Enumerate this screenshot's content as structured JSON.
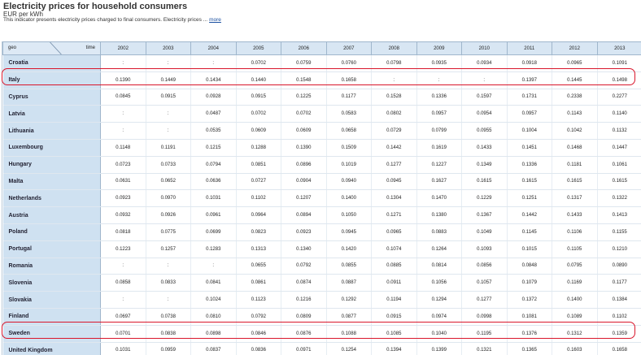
{
  "header": {
    "title": "Electricity prices for household consumers",
    "unit": "EUR per kWh",
    "description": "This indicator presents electricity prices charged to final consumers. Electricity prices ...",
    "more_label": "more"
  },
  "table": {
    "corner_geo": "geo",
    "corner_time": "time",
    "years": [
      "2002",
      "2003",
      "2004",
      "2005",
      "2006",
      "2007",
      "2008",
      "2009",
      "2010",
      "2011",
      "2012",
      "2013"
    ],
    "rows": [
      {
        "geo": "Croatia",
        "values": [
          ":",
          ":",
          ":",
          "0.0702",
          "0.0759",
          "0.0760",
          "0.0798",
          "0.0935",
          "0.0934",
          "0.0918",
          "0.0965",
          "0.1091"
        ]
      },
      {
        "geo": "Italy",
        "values": [
          "0.1390",
          "0.1449",
          "0.1434",
          "0.1440",
          "0.1548",
          "0.1658",
          ":",
          ":",
          ":",
          "0.1397",
          "0.1445",
          "0.1498"
        ]
      },
      {
        "geo": "Cyprus",
        "values": [
          "0.0845",
          "0.0915",
          "0.0928",
          "0.0915",
          "0.1225",
          "0.1177",
          "0.1528",
          "0.1336",
          "0.1597",
          "0.1731",
          "0.2338",
          "0.2277"
        ]
      },
      {
        "geo": "Latvia",
        "values": [
          ":",
          ":",
          "0.0487",
          "0.0702",
          "0.0702",
          "0.0583",
          "0.0802",
          "0.0957",
          "0.0954",
          "0.0957",
          "0.1143",
          "0.1140"
        ]
      },
      {
        "geo": "Lithuania",
        "values": [
          ":",
          ":",
          "0.0535",
          "0.0609",
          "0.0609",
          "0.0658",
          "0.0729",
          "0.0799",
          "0.0955",
          "0.1004",
          "0.1042",
          "0.1132"
        ]
      },
      {
        "geo": "Luxembourg",
        "values": [
          "0.1148",
          "0.1191",
          "0.1215",
          "0.1288",
          "0.1390",
          "0.1509",
          "0.1442",
          "0.1619",
          "0.1433",
          "0.1451",
          "0.1468",
          "0.1447"
        ]
      },
      {
        "geo": "Hungary",
        "values": [
          "0.0723",
          "0.0733",
          "0.0794",
          "0.0851",
          "0.0896",
          "0.1019",
          "0.1277",
          "0.1227",
          "0.1349",
          "0.1336",
          "0.1181",
          "0.1061"
        ]
      },
      {
        "geo": "Malta",
        "values": [
          "0.0631",
          "0.0652",
          "0.0636",
          "0.0727",
          "0.0904",
          "0.0940",
          "0.0945",
          "0.1627",
          "0.1615",
          "0.1615",
          "0.1615",
          "0.1615"
        ]
      },
      {
        "geo": "Netherlands",
        "values": [
          "0.0923",
          "0.0970",
          "0.1031",
          "0.1102",
          "0.1207",
          "0.1400",
          "0.1304",
          "0.1470",
          "0.1229",
          "0.1251",
          "0.1317",
          "0.1322"
        ]
      },
      {
        "geo": "Austria",
        "values": [
          "0.0932",
          "0.0926",
          "0.0961",
          "0.0964",
          "0.0894",
          "0.1050",
          "0.1271",
          "0.1380",
          "0.1367",
          "0.1442",
          "0.1433",
          "0.1413"
        ]
      },
      {
        "geo": "Poland",
        "values": [
          "0.0818",
          "0.0775",
          "0.0699",
          "0.0823",
          "0.0923",
          "0.0945",
          "0.0965",
          "0.0883",
          "0.1049",
          "0.1145",
          "0.1106",
          "0.1155"
        ]
      },
      {
        "geo": "Portugal",
        "values": [
          "0.1223",
          "0.1257",
          "0.1283",
          "0.1313",
          "0.1340",
          "0.1420",
          "0.1074",
          "0.1264",
          "0.1093",
          "0.1015",
          "0.1105",
          "0.1210"
        ]
      },
      {
        "geo": "Romania",
        "values": [
          ":",
          ":",
          ":",
          "0.0655",
          "0.0792",
          "0.0855",
          "0.0885",
          "0.0814",
          "0.0856",
          "0.0848",
          "0.0795",
          "0.0890"
        ]
      },
      {
        "geo": "Slovenia",
        "values": [
          "0.0858",
          "0.0833",
          "0.0841",
          "0.0861",
          "0.0874",
          "0.0887",
          "0.0911",
          "0.1056",
          "0.1057",
          "0.1079",
          "0.1169",
          "0.1177"
        ]
      },
      {
        "geo": "Slovakia",
        "values": [
          ":",
          ":",
          "0.1024",
          "0.1123",
          "0.1216",
          "0.1292",
          "0.1194",
          "0.1294",
          "0.1277",
          "0.1372",
          "0.1400",
          "0.1384"
        ]
      },
      {
        "geo": "Finland",
        "values": [
          "0.0697",
          "0.0738",
          "0.0810",
          "0.0792",
          "0.0809",
          "0.0877",
          "0.0915",
          "0.0974",
          "0.0998",
          "0.1081",
          "0.1089",
          "0.1102"
        ]
      },
      {
        "geo": "Sweden",
        "values": [
          "0.0701",
          "0.0838",
          "0.0898",
          "0.0846",
          "0.0876",
          "0.1088",
          "0.1085",
          "0.1040",
          "0.1195",
          "0.1376",
          "0.1312",
          "0.1359"
        ]
      },
      {
        "geo": "United Kingdom",
        "values": [
          "0.1031",
          "0.0959",
          "0.0837",
          "0.0836",
          "0.0971",
          "0.1254",
          "0.1394",
          "0.1399",
          "0.1321",
          "0.1365",
          "0.1603",
          "0.1658"
        ]
      }
    ]
  },
  "highlights": [
    "Italy",
    "Sweden"
  ],
  "colors": {
    "highlight": "#d9162b",
    "header_bg": "#d8e6f3",
    "geo_bg": "#cfe1f1"
  }
}
